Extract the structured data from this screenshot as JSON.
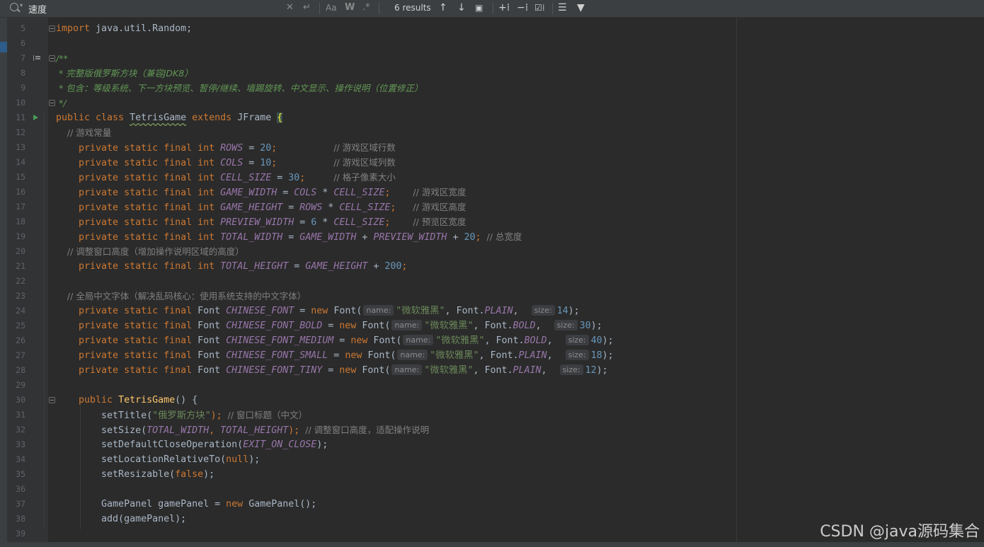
{
  "find_bar": {
    "query": "速度",
    "results": "6 results"
  },
  "gutter": {
    "line_numbers": [
      "5",
      "6",
      "7",
      "8",
      "9",
      "10",
      "11",
      "12",
      "13",
      "14",
      "15",
      "16",
      "17",
      "18",
      "19",
      "20",
      "21",
      "22",
      "23",
      "24",
      "25",
      "26",
      "27",
      "28",
      "29",
      "30",
      "31",
      "32",
      "33",
      "34",
      "35",
      "36",
      "37",
      "38",
      "39"
    ]
  },
  "code": {
    "l5": [
      "import",
      " java.util.Random;"
    ],
    "l7": "/**",
    "l8": " * 完整版俄罗斯方块（兼容JDK8）",
    "l9": " * 包含：等级系统、下一方块预览、暂停/继续、墙踢旋转、中文显示、操作说明（位置修正）",
    "l10": " */",
    "l11": [
      "public class ",
      "TetrisGame",
      " extends ",
      "JFrame ",
      "{"
    ],
    "l12": "    // 游戏常量",
    "l13": [
      "    private static final int ",
      "ROWS",
      " = ",
      "20",
      ";          ",
      "// 游戏区域行数"
    ],
    "l14": [
      "    private static final int ",
      "COLS",
      " = ",
      "10",
      ";          ",
      "// 游戏区域列数"
    ],
    "l15": [
      "    private static final int ",
      "CELL_SIZE",
      " = ",
      "30",
      ";     ",
      "// 格子像素大小"
    ],
    "l16": [
      "    private static final int ",
      "GAME_WIDTH",
      " = ",
      "COLS",
      " * ",
      "CELL_SIZE",
      ";    ",
      "// 游戏区宽度"
    ],
    "l17": [
      "    private static final int ",
      "GAME_HEIGHT",
      " = ",
      "ROWS",
      " * ",
      "CELL_SIZE",
      ";   ",
      "// 游戏区高度"
    ],
    "l18": [
      "    private static final int ",
      "PREVIEW_WIDTH",
      " = ",
      "6",
      " * ",
      "CELL_SIZE",
      ";    ",
      "// 预览区宽度"
    ],
    "l19": [
      "    private static final int ",
      "TOTAL_WIDTH",
      " = ",
      "GAME_WIDTH",
      " + ",
      "PREVIEW_WIDTH",
      " + ",
      "20",
      "; ",
      "// 总宽度"
    ],
    "l20": "    // 调整窗口高度（增加操作说明区域的高度）",
    "l21": [
      "    private static final int ",
      "TOTAL_HEIGHT",
      " = ",
      "GAME_HEIGHT",
      " + ",
      "200",
      ";"
    ],
    "l23": "    // 全局中文字体（解决乱码核心：使用系统支持的中文字体）",
    "l24": [
      "    private static final ",
      "Font ",
      "CHINESE_FONT",
      " = ",
      "new ",
      "Font(",
      "name:",
      "\"微软雅黑\"",
      ", Font.",
      "PLAIN",
      ",  ",
      "size:",
      "14",
      ");"
    ],
    "l25": [
      "    private static final ",
      "Font ",
      "CHINESE_FONT_BOLD",
      " = ",
      "new ",
      "Font(",
      "name:",
      "\"微软雅黑\"",
      ", Font.",
      "BOLD",
      ",  ",
      "size:",
      "30",
      ");"
    ],
    "l26": [
      "    private static final ",
      "Font ",
      "CHINESE_FONT_MEDIUM",
      " = ",
      "new ",
      "Font(",
      "name:",
      "\"微软雅黑\"",
      ", Font.",
      "BOLD",
      ",  ",
      "size:",
      "40",
      ");"
    ],
    "l27": [
      "    private static final ",
      "Font ",
      "CHINESE_FONT_SMALL",
      " = ",
      "new ",
      "Font(",
      "name:",
      "\"微软雅黑\"",
      ", Font.",
      "PLAIN",
      ",  ",
      "size:",
      "18",
      ");"
    ],
    "l28": [
      "    private static final ",
      "Font ",
      "CHINESE_FONT_TINY",
      " = ",
      "new ",
      "Font(",
      "name:",
      "\"微软雅黑\"",
      ", Font.",
      "PLAIN",
      ",  ",
      "size:",
      "12",
      ");"
    ],
    "l30": [
      "    public ",
      "TetrisGame",
      "() {"
    ],
    "l31": [
      "        setTitle(",
      "\"俄罗斯方块\"",
      "); ",
      "// 窗口标题（中文）"
    ],
    "l32": [
      "        setSize(",
      "TOTAL_WIDTH",
      ", ",
      "TOTAL_HEIGHT",
      "); ",
      "// 调整窗口高度，适配操作说明"
    ],
    "l33": [
      "        setDefaultCloseOperation(",
      "EXIT_ON_CLOSE",
      ");"
    ],
    "l34": [
      "        setLocationRelativeTo(",
      "null",
      ");"
    ],
    "l35": [
      "        setResizable(",
      "false",
      ");"
    ],
    "l37": [
      "        GamePanel gamePanel = ",
      "new ",
      "GamePanel();"
    ],
    "l38": "        add(gamePanel);"
  },
  "watermark": "CSDN @java源码集合"
}
